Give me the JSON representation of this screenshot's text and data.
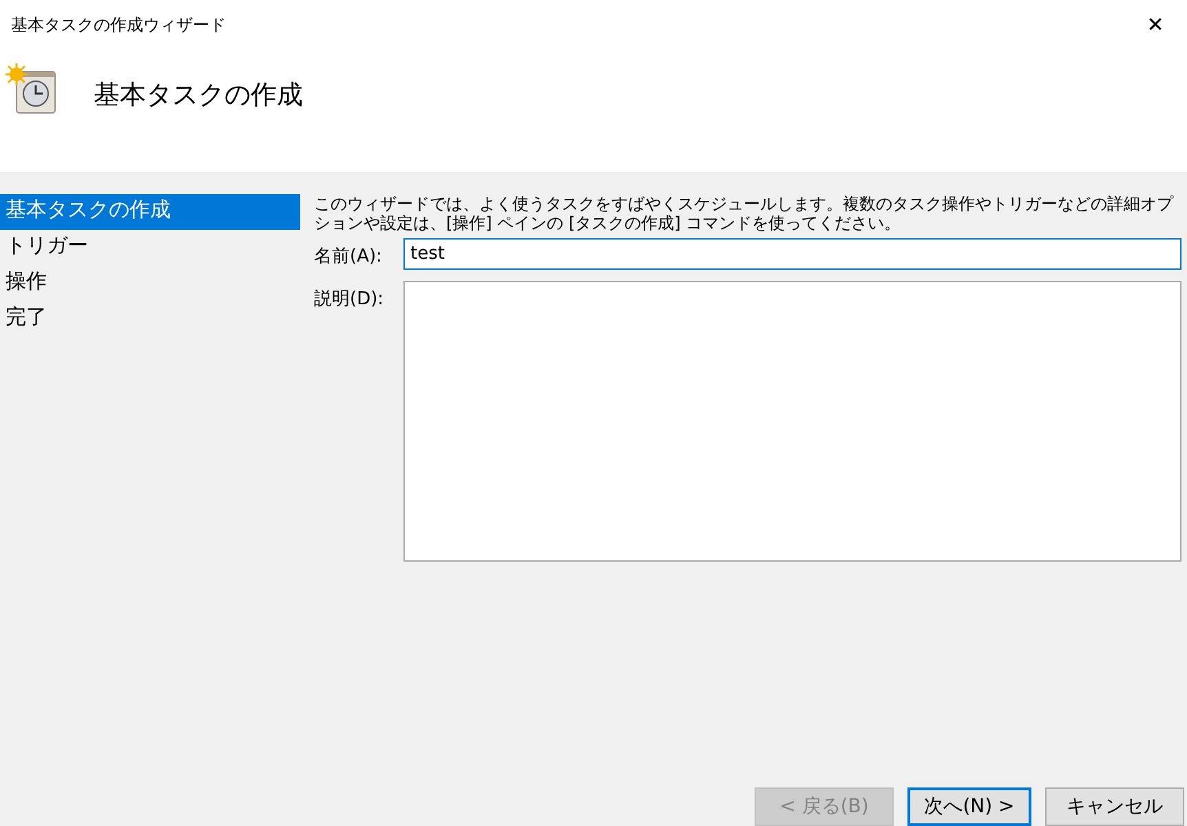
{
  "window": {
    "title": "基本タスクの作成ウィザード",
    "close": "✕"
  },
  "header": {
    "title": "基本タスクの作成"
  },
  "sidebar": {
    "items": [
      {
        "label": "基本タスクの作成",
        "selected": true
      },
      {
        "label": "トリガー",
        "selected": false
      },
      {
        "label": "操作",
        "selected": false
      },
      {
        "label": "完了",
        "selected": false
      }
    ]
  },
  "description": "このウィザードでは、よく使うタスクをすばやくスケジュールします。複数のタスク操作やトリガーなどの詳細オプションや設定は、[操作] ペインの [タスクの作成] コマンドを使ってください。",
  "fields": [
    {
      "kind": "line",
      "label": "名前(A):",
      "value": "test"
    },
    {
      "kind": "area",
      "label": "説明(D):"
    }
  ],
  "buttons": [
    {
      "label": "< 戻る(B)",
      "disabled": true,
      "default": false
    },
    {
      "label": "次へ(N) >",
      "disabled": false,
      "default": true
    },
    {
      "label": "キャンセル",
      "disabled": false,
      "default": false
    }
  ]
}
